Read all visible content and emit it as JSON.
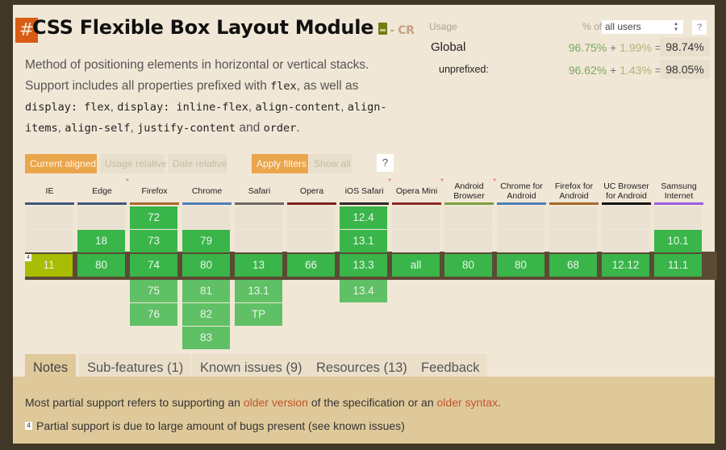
{
  "feature": {
    "anchor": "#",
    "title": "CSS Flexible Box Layout Module",
    "spec_icon": "document-icon",
    "spec_status": "- CR",
    "description_parts": [
      {
        "t": "text",
        "v": "Method of positioning elements in horizontal or vertical stacks. Support includes all properties prefixed with "
      },
      {
        "t": "code",
        "v": "flex"
      },
      {
        "t": "text",
        "v": ", as well as "
      },
      {
        "t": "code",
        "v": "display: flex"
      },
      {
        "t": "text",
        "v": ", "
      },
      {
        "t": "code",
        "v": "display: inline-flex"
      },
      {
        "t": "text",
        "v": ", "
      },
      {
        "t": "code",
        "v": "align-content"
      },
      {
        "t": "text",
        "v": ", "
      },
      {
        "t": "code",
        "v": "align-items"
      },
      {
        "t": "text",
        "v": ", "
      },
      {
        "t": "code",
        "v": "align-self"
      },
      {
        "t": "text",
        "v": ", "
      },
      {
        "t": "code",
        "v": "justify-content"
      },
      {
        "t": "text",
        "v": " and "
      },
      {
        "t": "code",
        "v": "order"
      },
      {
        "t": "text",
        "v": "."
      }
    ]
  },
  "usage": {
    "label": "Usage",
    "pct_of": "% of",
    "selected_users": "all users",
    "help": "?",
    "rows": [
      {
        "label": "Global",
        "full": "96.75%",
        "plus": "+",
        "partial": "1.99%",
        "eq": "=",
        "total": "98.74%"
      },
      {
        "label": "unprefixed:",
        "full": "96.62%",
        "plus": "+",
        "partial": "1.43%",
        "eq": "=",
        "total": "98.05%"
      }
    ]
  },
  "view_buttons": [
    {
      "label": "Current aligned",
      "active": true
    },
    {
      "label": "Usage relative",
      "active": false
    },
    {
      "label": "Date relative",
      "active": false
    }
  ],
  "filter_buttons": [
    {
      "label": "Apply filters",
      "active": true
    },
    {
      "label": "Show all",
      "active": false
    }
  ],
  "help_button": "?",
  "colors": {
    "supported": "#39b54a",
    "supported_future": "#5fc066",
    "partial": "#a8bd04",
    "accent": "#eba54b",
    "anchor": "#d85c14"
  },
  "browsers": [
    {
      "name": "IE",
      "star": false,
      "bar": "#3f5878",
      "past": [
        "",
        ""
      ],
      "current": {
        "v": "11",
        "s": "a",
        "note": "4"
      },
      "future": [
        "",
        "",
        ""
      ]
    },
    {
      "name": "Edge",
      "star": true,
      "bar": "#3f5878",
      "past": [
        "",
        "18"
      ],
      "current": {
        "v": "80",
        "s": "y"
      },
      "future": [
        "",
        "",
        ""
      ]
    },
    {
      "name": "Firefox",
      "star": false,
      "bar": "#a5692e",
      "past": [
        "72",
        "73"
      ],
      "current": {
        "v": "74",
        "s": "y"
      },
      "future": [
        "75",
        "76",
        ""
      ]
    },
    {
      "name": "Chrome",
      "star": false,
      "bar": "#4d7fbb",
      "past": [
        "",
        "79"
      ],
      "current": {
        "v": "80",
        "s": "y"
      },
      "future": [
        "81",
        "82",
        "83"
      ]
    },
    {
      "name": "Safari",
      "star": false,
      "bar": "#6d6a63",
      "past": [
        "",
        ""
      ],
      "current": {
        "v": "13",
        "s": "y"
      },
      "future": [
        "13.1",
        "TP",
        ""
      ]
    },
    {
      "name": "Opera",
      "star": false,
      "bar": "#7d2222",
      "past": [
        "",
        ""
      ],
      "current": {
        "v": "66",
        "s": "y"
      },
      "future": [
        "",
        "",
        ""
      ]
    },
    {
      "name": "iOS Safari",
      "star": true,
      "bar": "#2c2a26",
      "past": [
        "12.4",
        "13.1"
      ],
      "current": {
        "v": "13.3",
        "s": "y"
      },
      "future": [
        "13.4",
        "",
        ""
      ]
    },
    {
      "name": "Opera Mini",
      "star": true,
      "bar": "#8a2a25",
      "past": [
        "",
        ""
      ],
      "current": {
        "v": "all",
        "s": "y"
      },
      "future": [
        "",
        "",
        ""
      ]
    },
    {
      "name": "Android Browser",
      "star": true,
      "bar": "#7b9f43",
      "past": [
        "",
        ""
      ],
      "current": {
        "v": "80",
        "s": "y"
      },
      "future": [
        "",
        "",
        ""
      ]
    },
    {
      "name": "Chrome for Android",
      "star": false,
      "bar": "#4d7fbb",
      "past": [
        "",
        ""
      ],
      "current": {
        "v": "80",
        "s": "y"
      },
      "future": [
        "",
        "",
        ""
      ]
    },
    {
      "name": "Firefox for Android",
      "star": false,
      "bar": "#a5692e",
      "past": [
        "",
        ""
      ],
      "current": {
        "v": "68",
        "s": "y"
      },
      "future": [
        "",
        "",
        ""
      ]
    },
    {
      "name": "UC Browser for Android",
      "star": false,
      "bar": "#111111",
      "past": [
        "",
        ""
      ],
      "current": {
        "v": "12.12",
        "s": "y"
      },
      "future": [
        "",
        "",
        ""
      ]
    },
    {
      "name": "Samsung Internet",
      "star": false,
      "bar": "#9a5ee0",
      "past": [
        "",
        "10.1"
      ],
      "current": {
        "v": "11.1",
        "s": "y"
      },
      "future": [
        "",
        "",
        ""
      ]
    }
  ],
  "tabs": [
    {
      "label": "Notes",
      "active": true
    },
    {
      "label": "Sub-features (1)",
      "active": false
    },
    {
      "label": "Known issues (9)",
      "active": false
    },
    {
      "label": "Resources (13)",
      "active": false
    },
    {
      "label": "Feedback",
      "active": false
    }
  ],
  "notes": {
    "general": {
      "pre": "Most partial support refers to supporting an ",
      "link1": "older version",
      "mid": " of the specification or an ",
      "link2": "older syntax",
      "post": "."
    },
    "numbered": [
      {
        "num": "4",
        "text": "Partial support is due to large amount of bugs present (see known issues)"
      }
    ]
  }
}
